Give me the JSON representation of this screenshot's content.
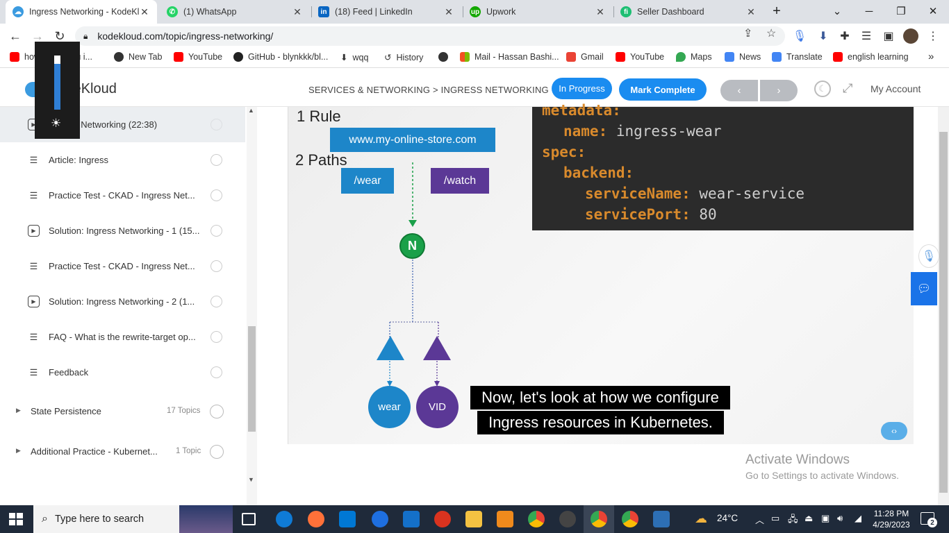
{
  "browser": {
    "tabs": [
      {
        "title": "Ingress Networking - KodeKl",
        "icon": "kodekloud-icon",
        "color": "#3b9be0",
        "active": true
      },
      {
        "title": "(1) WhatsApp",
        "icon": "whatsapp-icon",
        "color": "#25d366"
      },
      {
        "title": "(18) Feed | LinkedIn",
        "icon": "linkedin-icon",
        "color": "#0a66c2"
      },
      {
        "title": "Upwork",
        "icon": "upwork-icon",
        "color": "#14a800"
      },
      {
        "title": "Seller Dashboard",
        "icon": "fiverr-icon",
        "color": "#1dbf73"
      }
    ],
    "new_tab": "+",
    "url": "kodekloud.com/topic/ingress-networking/",
    "bookmarks": [
      {
        "label": "how to … urdu i...",
        "color": "#ff0000"
      },
      {
        "label": "New Tab",
        "color": "#333333"
      },
      {
        "label": "YouTube",
        "color": "#ff0000"
      },
      {
        "label": "GitHub - blynkkk/bl...",
        "color": "#222222"
      },
      {
        "label": "wqq",
        "color": "#333333"
      },
      {
        "label": "History",
        "color": "#333333"
      },
      {
        "label": "",
        "color": "#333333"
      },
      {
        "label": "Mail - Hassan Bashi...",
        "color": "#f25022"
      },
      {
        "label": "Gmail",
        "color": "#ea4335"
      },
      {
        "label": "YouTube",
        "color": "#ff0000"
      },
      {
        "label": "Maps",
        "color": "#34a853"
      },
      {
        "label": "News",
        "color": "#4285f4"
      },
      {
        "label": "Translate",
        "color": "#4285f4"
      },
      {
        "label": "english learning",
        "color": "#ff0000"
      }
    ],
    "more": "»"
  },
  "header": {
    "logo": "KodeKloud",
    "breadcrumb": "SERVICES & NETWORKING > INGRESS NETWORKING",
    "status_label": "In Progress",
    "mark_complete_label": "Mark Complete",
    "prev": "‹",
    "next": "›",
    "account_label": "My Account",
    "accent": "#1a8cf0"
  },
  "sidebar": {
    "items": [
      {
        "label": "Ingress Networking (22:38)",
        "kind": "video",
        "active": true
      },
      {
        "label": "Article: Ingress",
        "kind": "article"
      },
      {
        "label": "Practice Test - CKAD - Ingress Net...",
        "kind": "article"
      },
      {
        "label": "Solution: Ingress Networking - 1 (15...",
        "kind": "video"
      },
      {
        "label": "Practice Test - CKAD - Ingress Net...",
        "kind": "article"
      },
      {
        "label": "Solution: Ingress Networking - 2 (1...",
        "kind": "video"
      },
      {
        "label": "FAQ - What is the rewrite-target op...",
        "kind": "article"
      },
      {
        "label": "Feedback",
        "kind": "article"
      }
    ],
    "groups": [
      {
        "label": "State Persistence",
        "count": "17 Topics"
      },
      {
        "label": "Additional Practice - Kubernet...",
        "count": "1 Topic"
      }
    ]
  },
  "video": {
    "rule_label": "1 Rule",
    "host": "www.my-online-store.com",
    "paths_label": "2 Paths",
    "path1": "/wear",
    "path2": "/watch",
    "node": "N",
    "pod1": "wear",
    "pod2": "VID",
    "code": [
      {
        "key": "metadata:",
        "value": ""
      },
      {
        "key": "name:",
        "value": " ingress-wear"
      },
      {
        "key": "spec:",
        "value": ""
      },
      {
        "key": "backend:",
        "value": ""
      },
      {
        "key": "serviceName:",
        "value": " wear-service"
      },
      {
        "key": "servicePort:",
        "value": " 80"
      }
    ],
    "caption_line1": "Now, let's look at how we configure",
    "caption_line2": "Ingress resources in Kubernetes.",
    "colors": {
      "blue": "#1d86c9",
      "purple": "#5b3896",
      "green": "#1aa049",
      "orange": "#d98a2c"
    }
  },
  "watermark": {
    "line1": "Activate Windows",
    "line2": "Go to Settings to activate Windows."
  },
  "taskbar": {
    "search_placeholder": "Type here to search",
    "weather": "24°C",
    "time": "11:28 PM",
    "date": "4/29/2023",
    "notifications": "2"
  }
}
